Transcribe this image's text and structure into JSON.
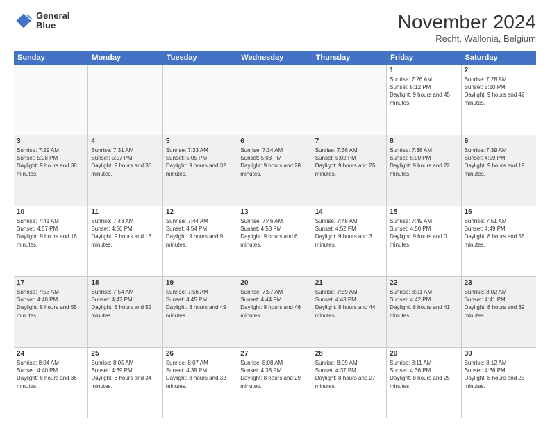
{
  "logo": {
    "line1": "General",
    "line2": "Blue"
  },
  "title": "November 2024",
  "subtitle": "Recht, Wallonia, Belgium",
  "header": {
    "days": [
      "Sunday",
      "Monday",
      "Tuesday",
      "Wednesday",
      "Thursday",
      "Friday",
      "Saturday"
    ]
  },
  "weeks": [
    {
      "alt": false,
      "cells": [
        {
          "day": "",
          "info": ""
        },
        {
          "day": "",
          "info": ""
        },
        {
          "day": "",
          "info": ""
        },
        {
          "day": "",
          "info": ""
        },
        {
          "day": "",
          "info": ""
        },
        {
          "day": "1",
          "info": "Sunrise: 7:26 AM\nSunset: 5:12 PM\nDaylight: 9 hours and 45 minutes."
        },
        {
          "day": "2",
          "info": "Sunrise: 7:28 AM\nSunset: 5:10 PM\nDaylight: 9 hours and 42 minutes."
        }
      ]
    },
    {
      "alt": true,
      "cells": [
        {
          "day": "3",
          "info": "Sunrise: 7:29 AM\nSunset: 5:08 PM\nDaylight: 9 hours and 38 minutes."
        },
        {
          "day": "4",
          "info": "Sunrise: 7:31 AM\nSunset: 5:07 PM\nDaylight: 9 hours and 35 minutes."
        },
        {
          "day": "5",
          "info": "Sunrise: 7:33 AM\nSunset: 5:05 PM\nDaylight: 9 hours and 32 minutes."
        },
        {
          "day": "6",
          "info": "Sunrise: 7:34 AM\nSunset: 5:03 PM\nDaylight: 9 hours and 28 minutes."
        },
        {
          "day": "7",
          "info": "Sunrise: 7:36 AM\nSunset: 5:02 PM\nDaylight: 9 hours and 25 minutes."
        },
        {
          "day": "8",
          "info": "Sunrise: 7:38 AM\nSunset: 5:00 PM\nDaylight: 9 hours and 22 minutes."
        },
        {
          "day": "9",
          "info": "Sunrise: 7:39 AM\nSunset: 4:59 PM\nDaylight: 9 hours and 19 minutes."
        }
      ]
    },
    {
      "alt": false,
      "cells": [
        {
          "day": "10",
          "info": "Sunrise: 7:41 AM\nSunset: 4:57 PM\nDaylight: 9 hours and 16 minutes."
        },
        {
          "day": "11",
          "info": "Sunrise: 7:43 AM\nSunset: 4:56 PM\nDaylight: 9 hours and 13 minutes."
        },
        {
          "day": "12",
          "info": "Sunrise: 7:44 AM\nSunset: 4:54 PM\nDaylight: 9 hours and 9 minutes."
        },
        {
          "day": "13",
          "info": "Sunrise: 7:46 AM\nSunset: 4:53 PM\nDaylight: 9 hours and 6 minutes."
        },
        {
          "day": "14",
          "info": "Sunrise: 7:48 AM\nSunset: 4:52 PM\nDaylight: 9 hours and 3 minutes."
        },
        {
          "day": "15",
          "info": "Sunrise: 7:49 AM\nSunset: 4:50 PM\nDaylight: 9 hours and 0 minutes."
        },
        {
          "day": "16",
          "info": "Sunrise: 7:51 AM\nSunset: 4:49 PM\nDaylight: 8 hours and 58 minutes."
        }
      ]
    },
    {
      "alt": true,
      "cells": [
        {
          "day": "17",
          "info": "Sunrise: 7:53 AM\nSunset: 4:48 PM\nDaylight: 8 hours and 55 minutes."
        },
        {
          "day": "18",
          "info": "Sunrise: 7:54 AM\nSunset: 4:47 PM\nDaylight: 8 hours and 52 minutes."
        },
        {
          "day": "19",
          "info": "Sunrise: 7:56 AM\nSunset: 4:45 PM\nDaylight: 8 hours and 49 minutes."
        },
        {
          "day": "20",
          "info": "Sunrise: 7:57 AM\nSunset: 4:44 PM\nDaylight: 8 hours and 46 minutes."
        },
        {
          "day": "21",
          "info": "Sunrise: 7:59 AM\nSunset: 4:43 PM\nDaylight: 8 hours and 44 minutes."
        },
        {
          "day": "22",
          "info": "Sunrise: 8:01 AM\nSunset: 4:42 PM\nDaylight: 8 hours and 41 minutes."
        },
        {
          "day": "23",
          "info": "Sunrise: 8:02 AM\nSunset: 4:41 PM\nDaylight: 8 hours and 39 minutes."
        }
      ]
    },
    {
      "alt": false,
      "cells": [
        {
          "day": "24",
          "info": "Sunrise: 8:04 AM\nSunset: 4:40 PM\nDaylight: 8 hours and 36 minutes."
        },
        {
          "day": "25",
          "info": "Sunrise: 8:05 AM\nSunset: 4:39 PM\nDaylight: 8 hours and 34 minutes."
        },
        {
          "day": "26",
          "info": "Sunrise: 8:07 AM\nSunset: 4:39 PM\nDaylight: 8 hours and 32 minutes."
        },
        {
          "day": "27",
          "info": "Sunrise: 8:08 AM\nSunset: 4:38 PM\nDaylight: 8 hours and 29 minutes."
        },
        {
          "day": "28",
          "info": "Sunrise: 8:09 AM\nSunset: 4:37 PM\nDaylight: 8 hours and 27 minutes."
        },
        {
          "day": "29",
          "info": "Sunrise: 8:11 AM\nSunset: 4:36 PM\nDaylight: 8 hours and 25 minutes."
        },
        {
          "day": "30",
          "info": "Sunrise: 8:12 AM\nSunset: 4:36 PM\nDaylight: 8 hours and 23 minutes."
        }
      ]
    }
  ]
}
